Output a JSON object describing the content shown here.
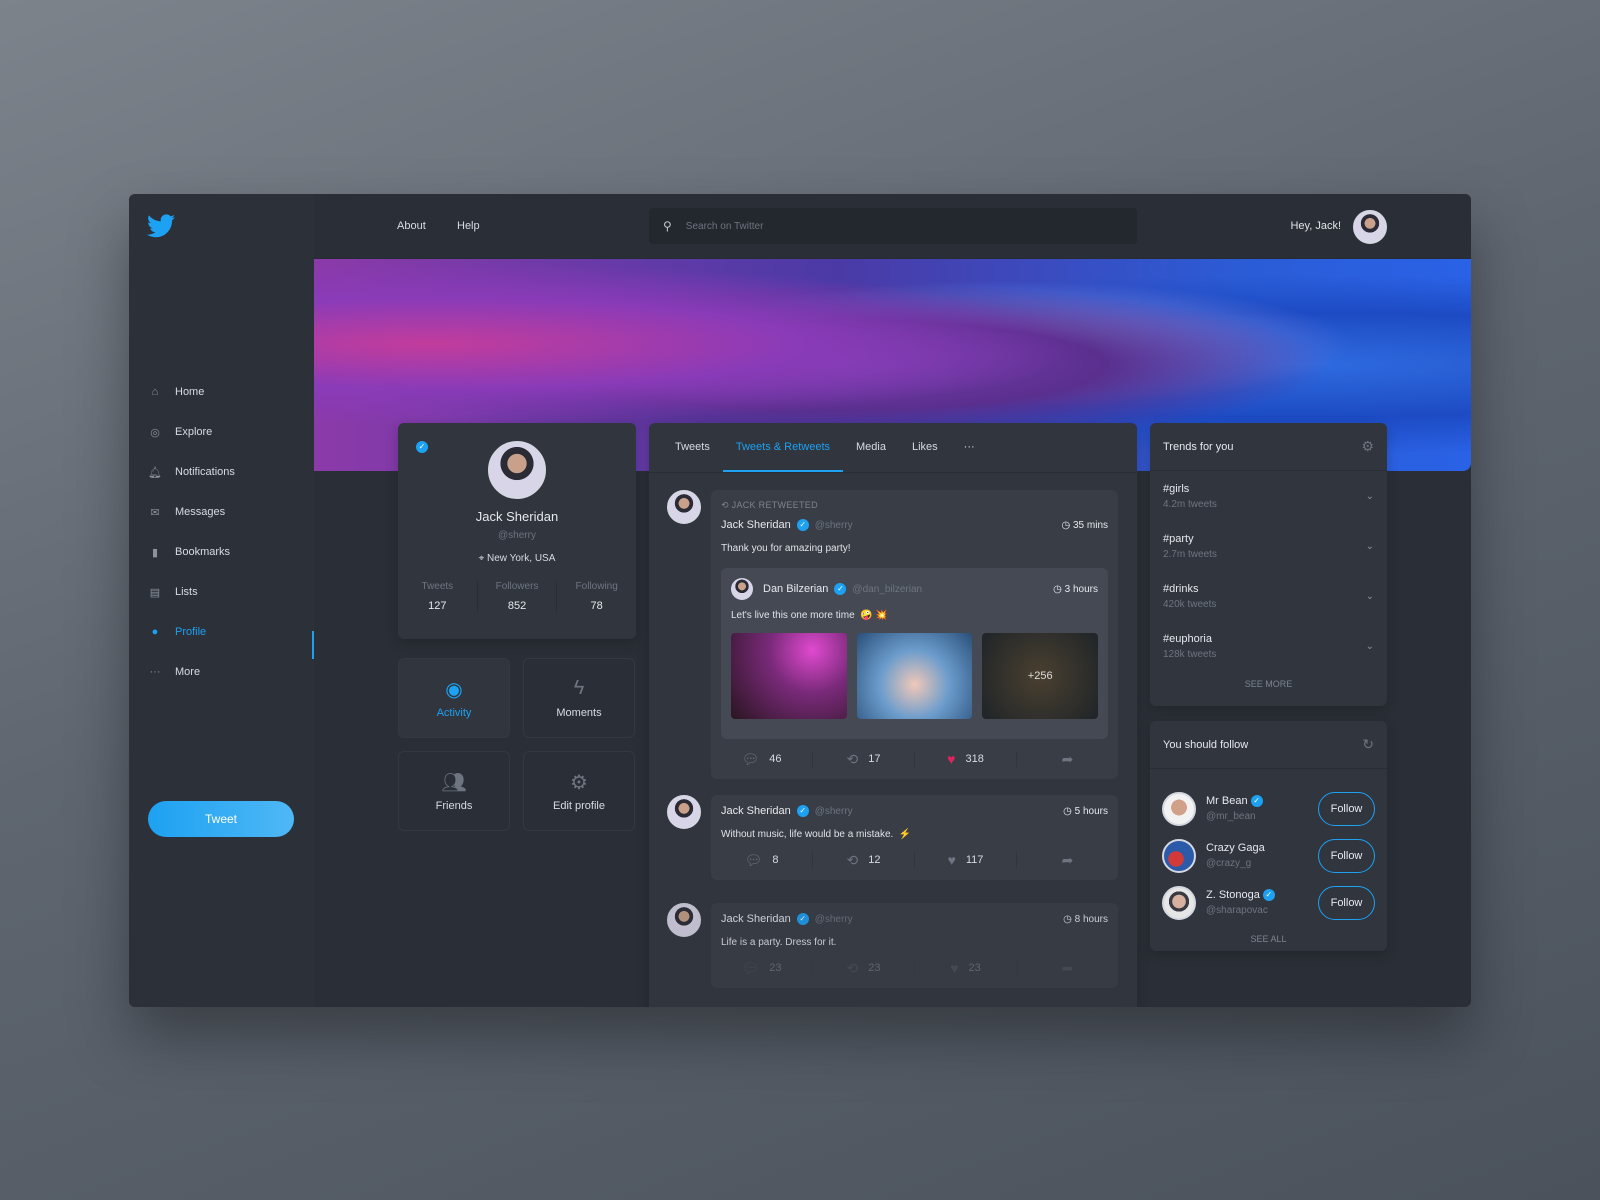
{
  "colors": {
    "accent": "#1da1f2",
    "background": "#2a2f37",
    "like": "#e0245e"
  },
  "topbar": {
    "links": [
      "About",
      "Help"
    ],
    "search_placeholder": "Search on Twitter",
    "greeting": "Hey, Jack!"
  },
  "sidebar": {
    "items": [
      {
        "label": "Home",
        "icon": "home-icon"
      },
      {
        "label": "Explore",
        "icon": "compass-icon"
      },
      {
        "label": "Notifications",
        "icon": "bell-icon"
      },
      {
        "label": "Messages",
        "icon": "mail-icon"
      },
      {
        "label": "Bookmarks",
        "icon": "bookmark-icon"
      },
      {
        "label": "Lists",
        "icon": "list-icon"
      },
      {
        "label": "Profile",
        "icon": "user-icon",
        "active": true
      },
      {
        "label": "More",
        "icon": "more-icon"
      }
    ],
    "tweet_button": "Tweet"
  },
  "profile": {
    "name": "Jack Sheridan",
    "handle": "@sherry",
    "location": "New York, USA",
    "stats": [
      {
        "label": "Tweets",
        "value": "127"
      },
      {
        "label": "Followers",
        "value": "852"
      },
      {
        "label": "Following",
        "value": "78"
      }
    ],
    "tiles": [
      "Activity",
      "Moments",
      "Friends",
      "Edit profile"
    ]
  },
  "feed": {
    "tabs": [
      "Tweets",
      "Tweets & Retweets",
      "Media",
      "Likes",
      "···"
    ],
    "active_tab": "Tweets & Retweets",
    "posts": [
      {
        "retweet_label": "JACK RETWEETED",
        "name": "Jack Sheridan",
        "handle": "@sherry",
        "time": "35 mins",
        "text": "Thank you for amazing party!",
        "quote": {
          "name": "Dan Bilzerian",
          "handle": "@dan_bilzerian",
          "time": "3 hours",
          "text": "Let's live this one more time",
          "emojis": "🤪 💥",
          "more_images": "+256"
        },
        "replies": "46",
        "retweets": "17",
        "likes": "318",
        "liked": true
      },
      {
        "name": "Jack Sheridan",
        "handle": "@sherry",
        "time": "5 hours",
        "text": "Without music, life would be a mistake.",
        "emoji": "⚡",
        "replies": "8",
        "retweets": "12",
        "likes": "117"
      },
      {
        "name": "Jack Sheridan",
        "handle": "@sherry",
        "time": "8 hours",
        "text": "Life is a party. Dress for it.",
        "replies": "23",
        "retweets": "23",
        "likes": "23"
      }
    ]
  },
  "trends": {
    "title": "Trends for you",
    "items": [
      {
        "tag": "#girls",
        "count": "4.2m tweets"
      },
      {
        "tag": "#party",
        "count": "2.7m tweets"
      },
      {
        "tag": "#drinks",
        "count": "420k tweets"
      },
      {
        "tag": "#euphoria",
        "count": "128k tweets"
      }
    ],
    "see_more": "SEE MORE"
  },
  "follow": {
    "title": "You should follow",
    "items": [
      {
        "name": "Mr Bean",
        "handle": "@mr_bean",
        "verified": true
      },
      {
        "name": "Crazy Gaga",
        "handle": "@crazy_g",
        "verified": false
      },
      {
        "name": "Z. Stonoga",
        "handle": "@sharapovac",
        "verified": true
      }
    ],
    "button": "Follow",
    "see_all": "SEE ALL"
  }
}
